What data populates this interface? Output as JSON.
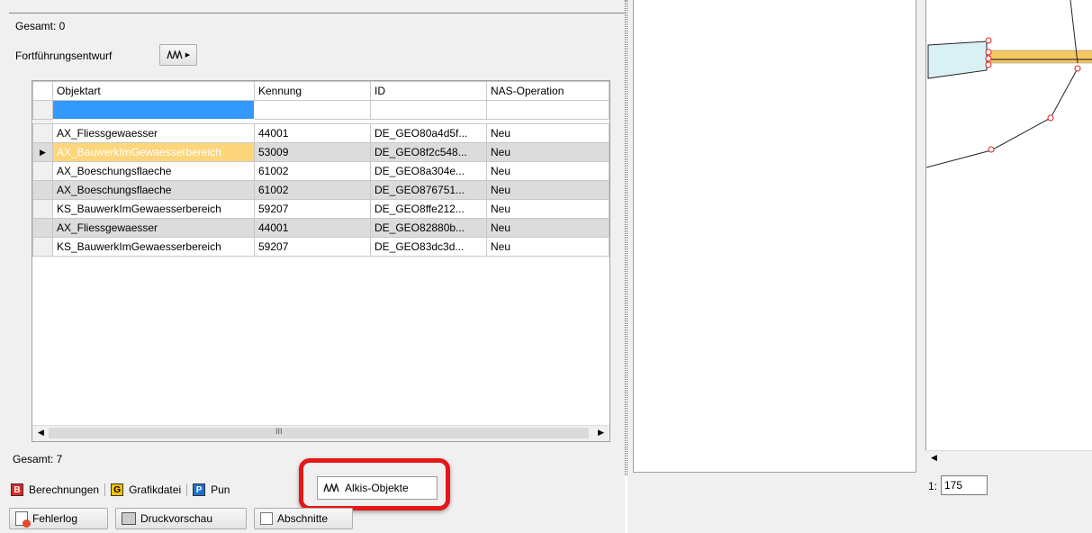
{
  "top_panel": {
    "gesamt_top": "Gesamt: 0",
    "fortfuehrung_label": "Fortführungsentwurf"
  },
  "grid": {
    "columns": [
      "Objektart",
      "Kennung",
      "ID",
      "NAS-Operation"
    ],
    "rows": [
      [
        "AX_Fliessgewaesser",
        "44001",
        "DE_GEO80a4d5f...",
        "Neu"
      ],
      [
        "AX_BauwerkImGewaesserbereich",
        "53009",
        "DE_GEO8f2c548...",
        "Neu"
      ],
      [
        "AX_Boeschungsflaeche",
        "61002",
        "DE_GEO8a304e...",
        "Neu"
      ],
      [
        "AX_Boeschungsflaeche",
        "61002",
        "DE_GEO876751...",
        "Neu"
      ],
      [
        "KS_BauwerkImGewaesserbereich",
        "59207",
        "DE_GEO8ffe212...",
        "Neu"
      ],
      [
        "AX_Fliessgewaesser",
        "44001",
        "DE_GEO82880b...",
        "Neu"
      ],
      [
        "KS_BauwerkImGewaesserbereich",
        "59207",
        "DE_GEO83dc3d...",
        "Neu"
      ]
    ],
    "selected_row": 1,
    "scroll_glyph": "III"
  },
  "footer": {
    "gesamt_bottom": "Gesamt: 7"
  },
  "tabs": [
    {
      "label": "Berechnungen",
      "icon_letter": "B",
      "icon_color": "#e32626"
    },
    {
      "label": "Grafikdatei",
      "icon_letter": "G",
      "icon_color": "#f2c200"
    },
    {
      "label": "Pun",
      "icon_letter": "P",
      "icon_color": "#1f6fd1"
    },
    {
      "label": "Alkis-Objekte",
      "icon": "alkis-icon"
    }
  ],
  "bottom_buttons": {
    "fehlerlog": "Fehlerlog",
    "druckvorschau": "Druckvorschau",
    "abschnitte": "Abschnitte"
  },
  "map": {
    "scale_prefix": "1:",
    "scale_value": "175"
  },
  "colors": {
    "highlight_red": "#e51717",
    "selected_cell": "#fdd57a",
    "edit_cell_blue": "#3399ff"
  }
}
